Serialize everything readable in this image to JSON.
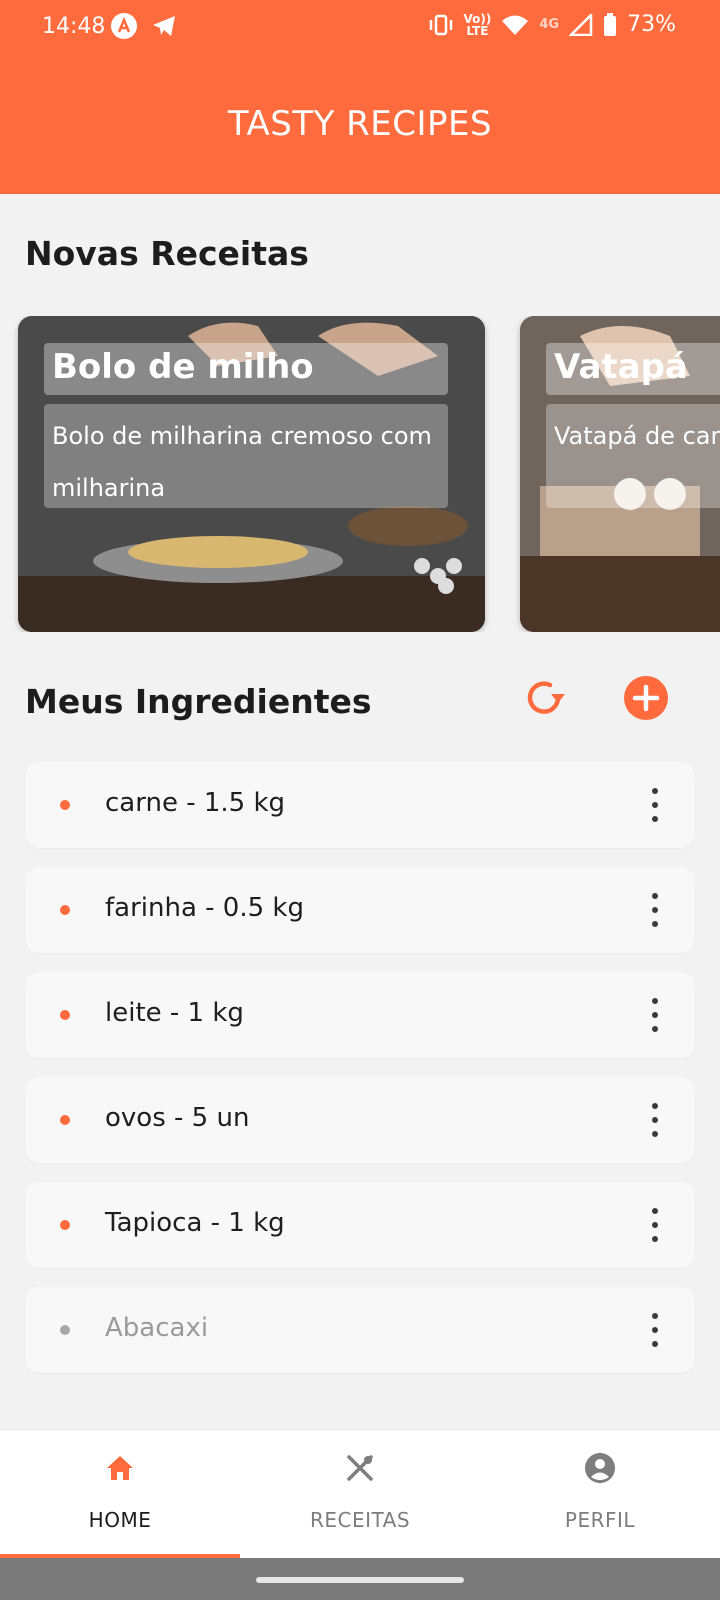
{
  "status_bar": {
    "time": "14:48",
    "network_top": "Vo))",
    "network_bottom": "LTE",
    "signal_type": "4G",
    "battery": "73%"
  },
  "header": {
    "title": "TASTY RECIPES"
  },
  "colors": {
    "accent": "#ff6b3d",
    "background": "#f2f2f2",
    "card_bg": "#f8f8f8"
  },
  "novas_receitas": {
    "title": "Novas Receitas",
    "cards": [
      {
        "title": "Bolo de milho",
        "description": "Bolo de milharina cremoso com milharina"
      },
      {
        "title": "Vatapá",
        "description": "Vatapá de camarão do pará"
      }
    ]
  },
  "meus_ingredientes": {
    "title": "Meus Ingredientes",
    "actions": {
      "refresh_icon": "refresh-icon",
      "add_icon": "add-circle-icon"
    },
    "items": [
      {
        "label": "carne - 1.5 kg",
        "muted": false
      },
      {
        "label": "farinha - 0.5 kg",
        "muted": false
      },
      {
        "label": "leite - 1 kg",
        "muted": false
      },
      {
        "label": "ovos - 5 un",
        "muted": false
      },
      {
        "label": "Tapioca - 1 kg",
        "muted": false
      },
      {
        "label": "Abacaxi",
        "muted": true
      }
    ]
  },
  "bottom_nav": {
    "items": [
      {
        "label": "HOME",
        "icon": "home-icon",
        "active": true
      },
      {
        "label": "RECEITAS",
        "icon": "utensils-icon",
        "active": false
      },
      {
        "label": "PERFIL",
        "icon": "profile-icon",
        "active": false
      }
    ]
  }
}
